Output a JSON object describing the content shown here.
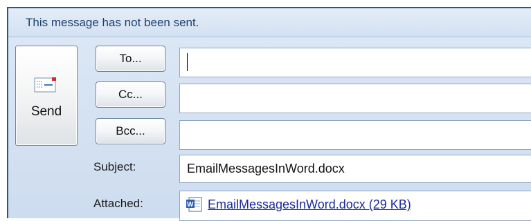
{
  "info_bar": {
    "text": "This message has not been sent."
  },
  "send_button": {
    "label": "Send",
    "icon": "send-envelope-icon"
  },
  "recipients": {
    "to_label": "To...",
    "to_value": "",
    "cc_label": "Cc...",
    "cc_value": "",
    "bcc_label": "Bcc...",
    "bcc_value": ""
  },
  "subject": {
    "label": "Subject:",
    "value": "EmailMessagesInWord.docx"
  },
  "attachment": {
    "label": "Attached:",
    "icon": "word-document-icon",
    "file": "EmailMessagesInWord.docx (29 KB)"
  },
  "colors": {
    "frame_border": "#2b5591",
    "header_background": "#d3e1f2",
    "link": "#1b2a9c"
  }
}
